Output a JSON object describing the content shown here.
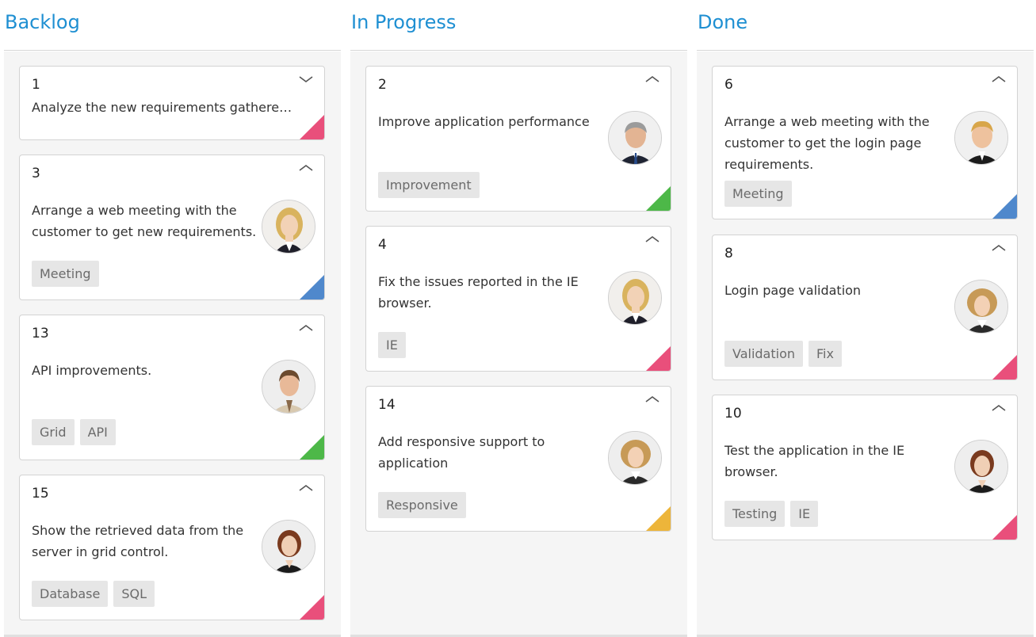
{
  "board": {
    "columns": [
      {
        "title": "Backlog",
        "cards": [
          {
            "id": "1",
            "text": "Analyze the new requirements gathered from the customer.",
            "tags": [],
            "priority_color": "#e94f7b",
            "collapsed": true
          },
          {
            "id": "3",
            "text": "Arrange a web meeting with the customer to get new requirements.",
            "tags": [
              "Meeting"
            ],
            "priority_color": "#4f88cc",
            "avatar": "woman-blonde"
          },
          {
            "id": "13",
            "text": "API improvements.",
            "tags": [
              "Grid",
              "API"
            ],
            "priority_color": "#4db848",
            "avatar": "man-young"
          },
          {
            "id": "15",
            "text": "Show the retrieved data from the server in grid control.",
            "tags": [
              "Database",
              "SQL"
            ],
            "priority_color": "#e94f7b",
            "avatar": "woman-short-hair"
          }
        ]
      },
      {
        "title": "In Progress",
        "cards": [
          {
            "id": "2",
            "text": "Improve application performance",
            "tags": [
              "Improvement"
            ],
            "priority_color": "#4db848",
            "avatar": "man-older"
          },
          {
            "id": "4",
            "text": "Fix the issues reported in the IE browser.",
            "tags": [
              "IE"
            ],
            "priority_color": "#e94f7b",
            "avatar": "woman-blonde"
          },
          {
            "id": "14",
            "text": "Add responsive support to application",
            "tags": [
              "Responsive"
            ],
            "priority_color": "#edb53a",
            "avatar": "woman-curly"
          }
        ]
      },
      {
        "title": "Done",
        "cards": [
          {
            "id": "6",
            "text": "Arrange a web meeting with the customer to get the login page requirements.",
            "tags": [
              "Meeting"
            ],
            "priority_color": "#4f88cc",
            "avatar": "man-blond"
          },
          {
            "id": "8",
            "text": "Login page validation",
            "tags": [
              "Validation",
              "Fix"
            ],
            "priority_color": "#e94f7b",
            "avatar": "woman-curly"
          },
          {
            "id": "10",
            "text": "Test the application in the IE browser.",
            "tags": [
              "Testing",
              "IE"
            ],
            "priority_color": "#e94f7b",
            "avatar": "woman-short-hair"
          }
        ]
      }
    ]
  },
  "icons": {
    "expand": "chevron-down-icon",
    "collapse": "chevron-up-icon",
    "priority": "priority-corner-icon",
    "assignee": "avatar"
  },
  "colors": {
    "accent": "#1e8fd2",
    "column_bg": "#f5f5f5",
    "tag_bg": "#e6e6e6",
    "tag_text": "#6b6b6b"
  }
}
